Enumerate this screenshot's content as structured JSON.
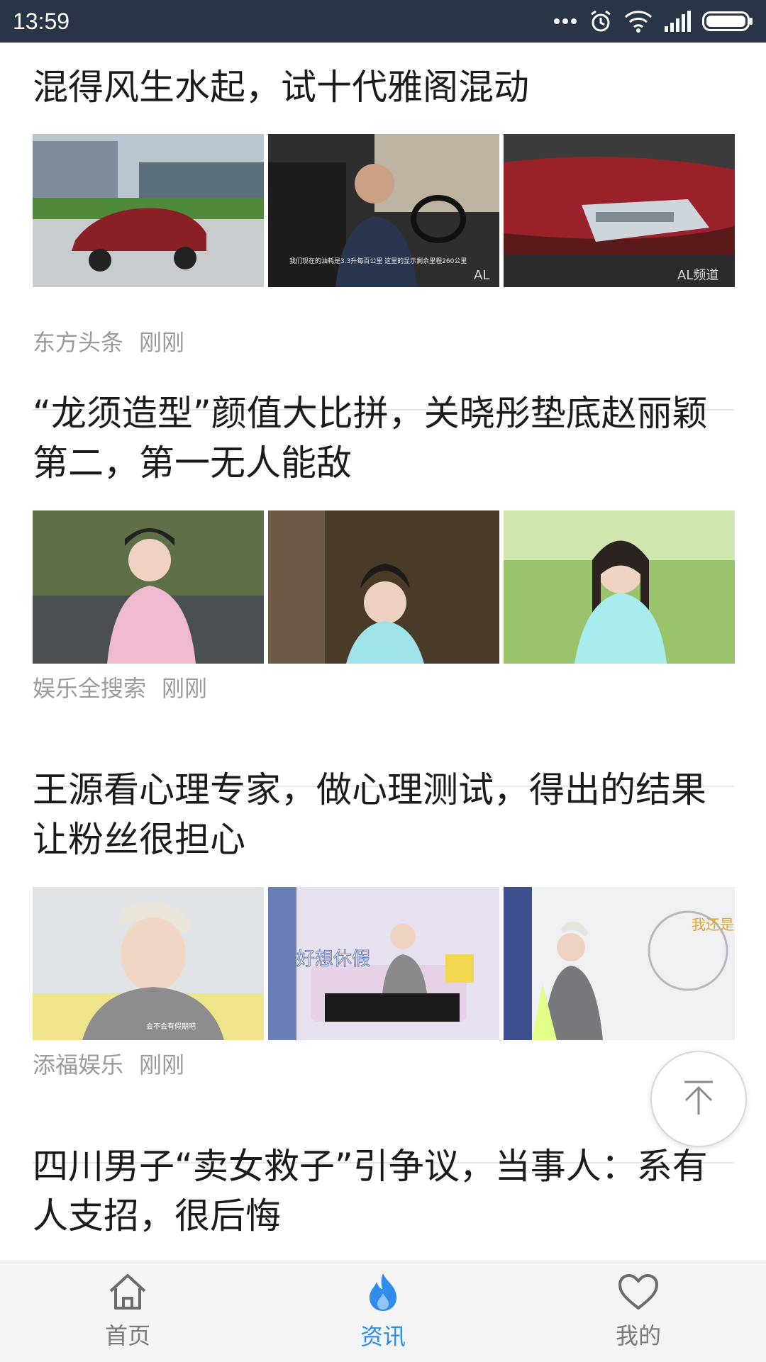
{
  "status_bar": {
    "time": "13:59",
    "icons": [
      "more-dots-icon",
      "alarm-icon",
      "wifi-icon",
      "signal-icon",
      "battery-icon"
    ]
  },
  "articles": [
    {
      "title": "混得风生水起，试十代雅阁混动",
      "source": "东方头条",
      "time": "刚刚",
      "images": [
        {
          "name": "red-sedan-exterior-photo",
          "caption": ""
        },
        {
          "name": "driver-in-car-photo",
          "caption": "我们现在的油耗是3.3升每百公里 这里的显示剩余里程260公里"
        },
        {
          "name": "red-car-headlight-photo",
          "caption": "AL频道"
        }
      ]
    },
    {
      "title": "“龙须造型”颜值大比拼，关晓彤垫底赵丽颖第二，第一无人能敌",
      "source": "娱乐全搜索",
      "time": "刚刚",
      "images": [
        {
          "name": "actress-pink-costume-photo",
          "caption": ""
        },
        {
          "name": "actress-temple-photo",
          "caption": ""
        },
        {
          "name": "actress-green-forest-photo",
          "caption": ""
        }
      ]
    },
    {
      "title": "王源看心理专家，做心理测试，得出的结果让粉丝很担心",
      "source": "添福娱乐",
      "time": "刚刚",
      "images": [
        {
          "name": "singer-closeup-photo",
          "caption": "会不会有假期吧"
        },
        {
          "name": "singer-sofa-photo",
          "caption": "好想休假"
        },
        {
          "name": "singer-whiteboard-photo",
          "caption": "我还是"
        }
      ]
    },
    {
      "title": "四川男子“卖女救子”引争议，当事人：系有人支招，很后悔"
    }
  ],
  "back_to_top": {
    "icon": "arrow-up-icon"
  },
  "bottom_nav": [
    {
      "label": "首页",
      "icon": "home-icon",
      "active": false
    },
    {
      "label": "资讯",
      "icon": "flame-icon",
      "active": true
    },
    {
      "label": "我的",
      "icon": "heart-icon",
      "active": false
    }
  ],
  "colors": {
    "status_bar_bg": "#2a3447",
    "accent": "#2f8ce8",
    "meta_text": "#9b9b9b",
    "title_text": "#1b1b1b"
  }
}
